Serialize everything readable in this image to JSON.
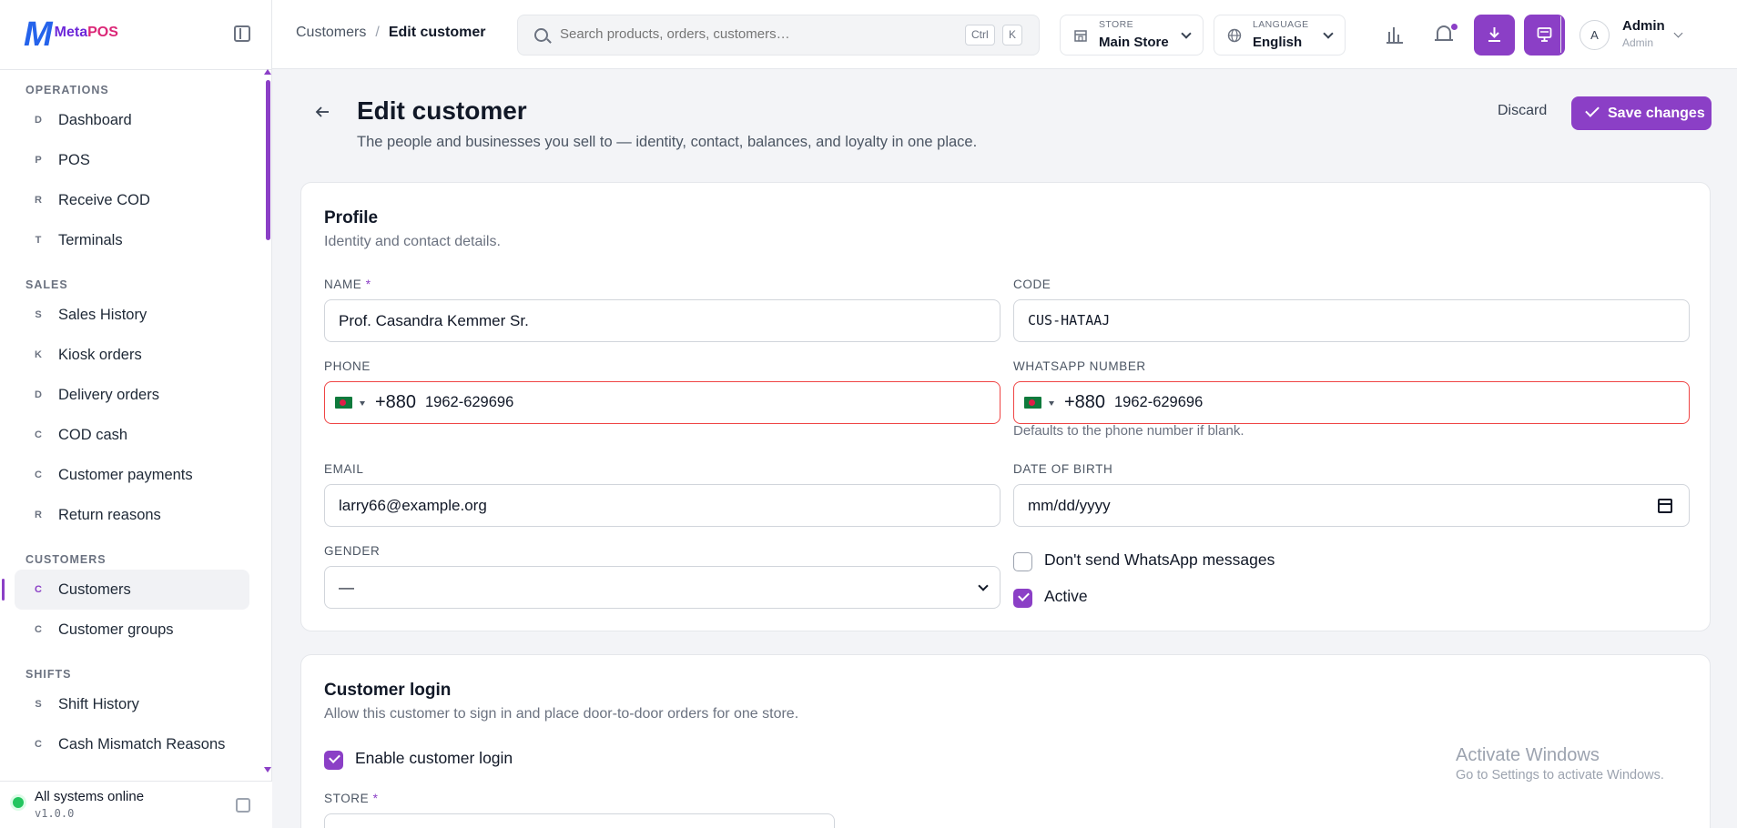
{
  "brand": {
    "logo_mark": "M",
    "logo_name": "Meta",
    "logo_name_accent": "POS"
  },
  "sidebar": {
    "sections": [
      {
        "title": "OPERATIONS",
        "items": [
          {
            "letter": "D",
            "label": "Dashboard"
          },
          {
            "letter": "P",
            "label": "POS"
          },
          {
            "letter": "R",
            "label": "Receive COD"
          },
          {
            "letter": "T",
            "label": "Terminals"
          }
        ]
      },
      {
        "title": "SALES",
        "items": [
          {
            "letter": "S",
            "label": "Sales History"
          },
          {
            "letter": "K",
            "label": "Kiosk orders"
          },
          {
            "letter": "D",
            "label": "Delivery orders"
          },
          {
            "letter": "C",
            "label": "COD cash"
          },
          {
            "letter": "C",
            "label": "Customer payments"
          },
          {
            "letter": "R",
            "label": "Return reasons"
          }
        ]
      },
      {
        "title": "CUSTOMERS",
        "items": [
          {
            "letter": "C",
            "label": "Customers",
            "active": true
          },
          {
            "letter": "C",
            "label": "Customer groups"
          }
        ]
      },
      {
        "title": "SHIFTS",
        "items": [
          {
            "letter": "S",
            "label": "Shift History"
          },
          {
            "letter": "C",
            "label": "Cash Mismatch Reasons"
          }
        ]
      }
    ],
    "footer": {
      "status": "All systems online",
      "version": "v1.0.0"
    }
  },
  "header": {
    "breadcrumb": {
      "parent": "Customers",
      "separator": "/",
      "current": "Edit customer"
    },
    "search": {
      "placeholder": "Search products, orders, customers…",
      "kbd1": "Ctrl",
      "kbd2": "K"
    },
    "store": {
      "caption": "STORE",
      "value": "Main Store"
    },
    "language": {
      "caption": "LANGUAGE",
      "value": "English"
    },
    "user": {
      "initial": "A",
      "name": "Admin",
      "role": "Admin"
    }
  },
  "page": {
    "title": "Edit customer",
    "subtitle": "The people and businesses you sell to — identity, contact, balances, and loyalty in one place.",
    "discard_label": "Discard",
    "save_label": "Save changes"
  },
  "profile": {
    "title": "Profile",
    "subtitle": "Identity and contact details.",
    "name": {
      "label": "NAME",
      "required": "*",
      "value": "Prof. Casandra Kemmer Sr."
    },
    "code": {
      "label": "CODE",
      "value": "CUS-HATAAJ"
    },
    "phone": {
      "label": "PHONE",
      "dial": "+880",
      "number": "1962-629696"
    },
    "whatsapp": {
      "label": "WHATSAPP NUMBER",
      "dial": "+880",
      "number": "1962-629696",
      "hint": "Defaults to the phone number if blank."
    },
    "email": {
      "label": "EMAIL",
      "value": "larry66@example.org"
    },
    "dob": {
      "label": "DATE OF BIRTH",
      "value": "mm/dd/yyyy"
    },
    "gender": {
      "label": "GENDER",
      "value": "—"
    },
    "no_whatsapp": {
      "label": "Don't send WhatsApp messages",
      "checked": false
    },
    "active": {
      "label": "Active",
      "checked": true
    }
  },
  "login": {
    "title": "Customer login",
    "subtitle": "Allow this customer to sign in and place door-to-door orders for one store.",
    "enable": {
      "label": "Enable customer login",
      "checked": true
    },
    "store_label": "STORE",
    "store_required": "*"
  },
  "watermark": {
    "line1": "Activate Windows",
    "line2": "Go to Settings to activate Windows."
  },
  "colors": {
    "accent": "#8b3fc6",
    "error": "#ef4444",
    "online": "#22c55e"
  }
}
